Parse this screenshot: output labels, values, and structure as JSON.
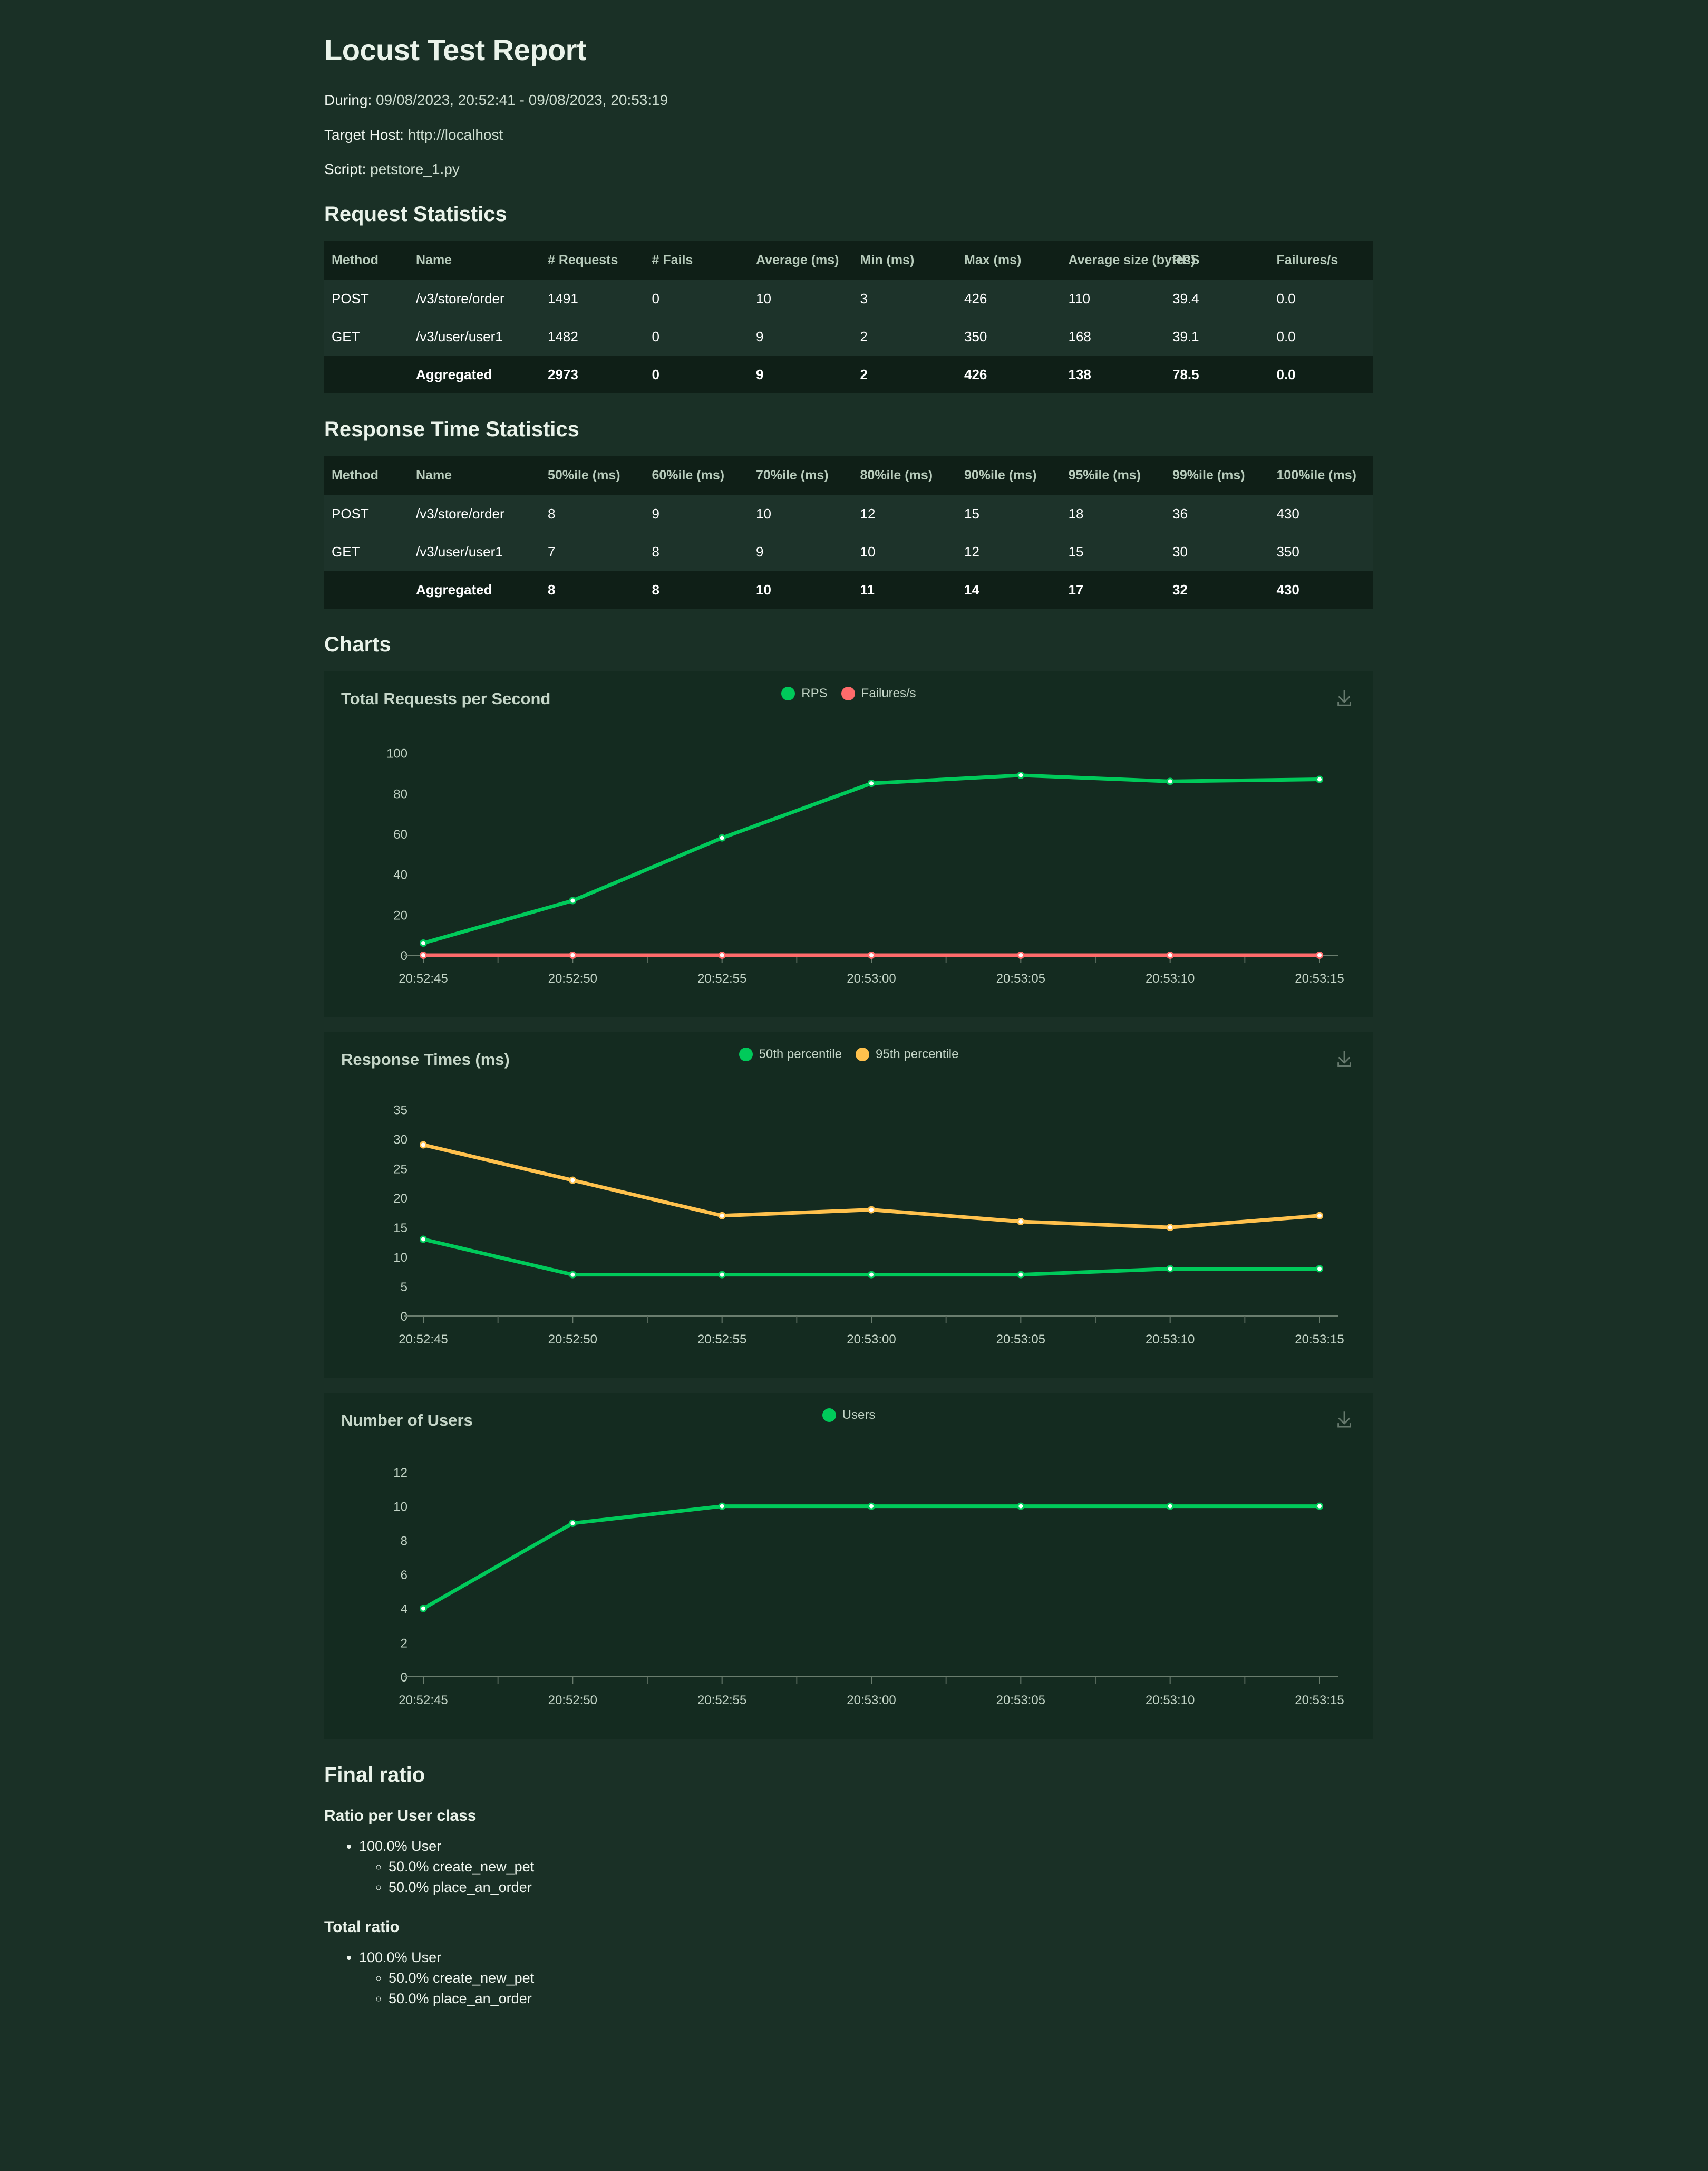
{
  "report": {
    "title": "Locust Test Report",
    "during_label": "During:",
    "during_value": "09/08/2023, 20:52:41 - 09/08/2023, 20:53:19",
    "host_label": "Target Host:",
    "host_value": "http://localhost",
    "script_label": "Script:",
    "script_value": "petstore_1.py"
  },
  "request_statistics": {
    "heading": "Request Statistics",
    "columns": [
      "Method",
      "Name",
      "# Requests",
      "# Fails",
      "Average (ms)",
      "Min (ms)",
      "Max (ms)",
      "Average size (bytes)",
      "RPS",
      "Failures/s"
    ],
    "rows": [
      [
        "POST",
        "/v3/store/order",
        "1491",
        "0",
        "10",
        "3",
        "426",
        "110",
        "39.4",
        "0.0"
      ],
      [
        "GET",
        "/v3/user/user1",
        "1482",
        "0",
        "9",
        "2",
        "350",
        "168",
        "39.1",
        "0.0"
      ]
    ],
    "total_row": [
      "",
      "Aggregated",
      "2973",
      "0",
      "9",
      "2",
      "426",
      "138",
      "78.5",
      "0.0"
    ]
  },
  "response_time_statistics": {
    "heading": "Response Time Statistics",
    "columns": [
      "Method",
      "Name",
      "50%ile (ms)",
      "60%ile (ms)",
      "70%ile (ms)",
      "80%ile (ms)",
      "90%ile (ms)",
      "95%ile (ms)",
      "99%ile (ms)",
      "100%ile (ms)"
    ],
    "rows": [
      [
        "POST",
        "/v3/store/order",
        "8",
        "9",
        "10",
        "12",
        "15",
        "18",
        "36",
        "430"
      ],
      [
        "GET",
        "/v3/user/user1",
        "7",
        "8",
        "9",
        "10",
        "12",
        "15",
        "30",
        "350"
      ]
    ],
    "total_row": [
      "",
      "Aggregated",
      "8",
      "8",
      "10",
      "11",
      "14",
      "17",
      "32",
      "430"
    ]
  },
  "charts_heading": "Charts",
  "colors": {
    "green": "#00ca5a",
    "red": "#ff6b6b",
    "yellow": "#ffc14d",
    "page_bg": "#1a3026",
    "panel_bg": "#142b20",
    "axis": "#c3d4c6"
  },
  "chart_data": [
    {
      "type": "line",
      "title": "Total Requests per Second",
      "x": [
        "20:52:45",
        "20:52:50",
        "20:52:55",
        "20:53:00",
        "20:53:05",
        "20:53:10",
        "20:53:15"
      ],
      "xlabel": "",
      "ylabel": "",
      "ylim": [
        0,
        108
      ],
      "yticks": [
        0,
        20,
        40,
        60,
        80,
        100
      ],
      "grid": false,
      "legend_position": "top-center",
      "download_icon": "download-icon",
      "series": [
        {
          "name": "RPS",
          "color": "#00ca5a",
          "values": [
            6,
            27,
            58,
            85,
            89,
            86,
            87
          ]
        },
        {
          "name": "Failures/s",
          "color": "#ff6b6b",
          "values": [
            0,
            0,
            0,
            0,
            0,
            0,
            0
          ]
        }
      ]
    },
    {
      "type": "line",
      "title": "Response Times (ms)",
      "x": [
        "20:52:45",
        "20:52:50",
        "20:52:55",
        "20:53:00",
        "20:53:05",
        "20:53:10",
        "20:53:15"
      ],
      "xlabel": "",
      "ylabel": "",
      "ylim": [
        0,
        37
      ],
      "yticks": [
        0,
        5,
        10,
        15,
        20,
        25,
        30,
        35
      ],
      "grid": false,
      "legend_position": "top-center",
      "download_icon": "download-icon",
      "series": [
        {
          "name": "50th percentile",
          "color": "#00ca5a",
          "values": [
            13,
            7,
            7,
            7,
            7,
            8,
            8
          ]
        },
        {
          "name": "95th percentile",
          "color": "#ffc14d",
          "values": [
            29,
            23,
            17,
            18,
            16,
            15,
            17
          ]
        }
      ]
    },
    {
      "type": "line",
      "title": "Number of Users",
      "x": [
        "20:52:45",
        "20:52:50",
        "20:52:55",
        "20:53:00",
        "20:53:05",
        "20:53:10",
        "20:53:15"
      ],
      "xlabel": "",
      "ylabel": "",
      "ylim": [
        0,
        12.8
      ],
      "yticks": [
        0,
        2,
        4,
        6,
        8,
        10,
        12
      ],
      "grid": false,
      "legend_position": "top-center",
      "download_icon": "download-icon",
      "series": [
        {
          "name": "Users",
          "color": "#00ca5a",
          "values": [
            4,
            9,
            10,
            10,
            10,
            10,
            10
          ]
        }
      ]
    }
  ],
  "final_ratio": {
    "heading": "Final ratio",
    "per_class_heading": "Ratio per User class",
    "per_class": {
      "root": "100.0% User",
      "children": [
        "50.0% create_new_pet",
        "50.0% place_an_order"
      ]
    },
    "total_heading": "Total ratio",
    "total": {
      "root": "100.0% User",
      "children": [
        "50.0% create_new_pet",
        "50.0% place_an_order"
      ]
    }
  }
}
